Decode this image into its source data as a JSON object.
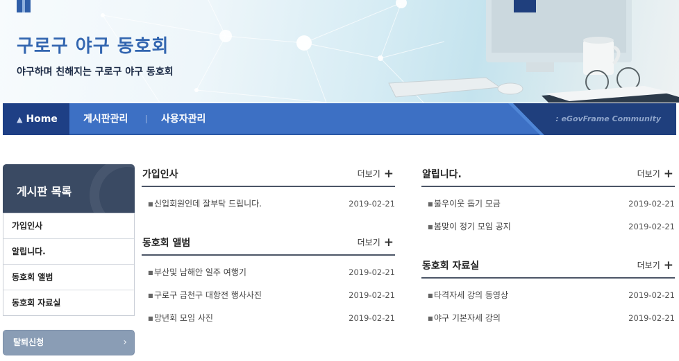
{
  "header": {
    "title": "구로구 야구 동호회",
    "subtitle": "야구하며 친해지는 구로구 야구 동호회"
  },
  "nav": {
    "home": "Home",
    "items": [
      "게시판관리",
      "사용자관리"
    ],
    "community": ": eGovFrame Community"
  },
  "sidebar": {
    "title": "게시판 목록",
    "items": [
      "가입인사",
      "알립니다.",
      "동호회 앨범",
      "동호회 자료실"
    ],
    "withdraw": "탈퇴신청"
  },
  "more_label": "더보기",
  "boards": [
    {
      "title": "가입인사",
      "posts": [
        {
          "title": "신입회원인데 잘부탁 드립니다.",
          "date": "2019-02-21"
        }
      ]
    },
    {
      "title": "동호회 앨범",
      "posts": [
        {
          "title": "부산및 남해안 일주 여행기",
          "date": "2019-02-21"
        },
        {
          "title": "구로구 금천구 대항전 행사사진",
          "date": "2019-02-21"
        },
        {
          "title": "망년회 모임 사진",
          "date": "2019-02-21"
        }
      ]
    },
    {
      "title": "알립니다.",
      "posts": [
        {
          "title": "불우이웃 돕기 모금",
          "date": "2019-02-21"
        },
        {
          "title": "봄맞이 정기 모임 공지",
          "date": "2019-02-21"
        }
      ]
    },
    {
      "title": "동호회 자료실",
      "posts": [
        {
          "title": "타격자세 강의 동영상",
          "date": "2019-02-21"
        },
        {
          "title": "야구 기본자세 강의",
          "date": "2019-02-21"
        }
      ]
    }
  ],
  "colors": {
    "accent": "#3366b0",
    "nav": "#3d70c4",
    "nav_home": "#1e3f85"
  }
}
